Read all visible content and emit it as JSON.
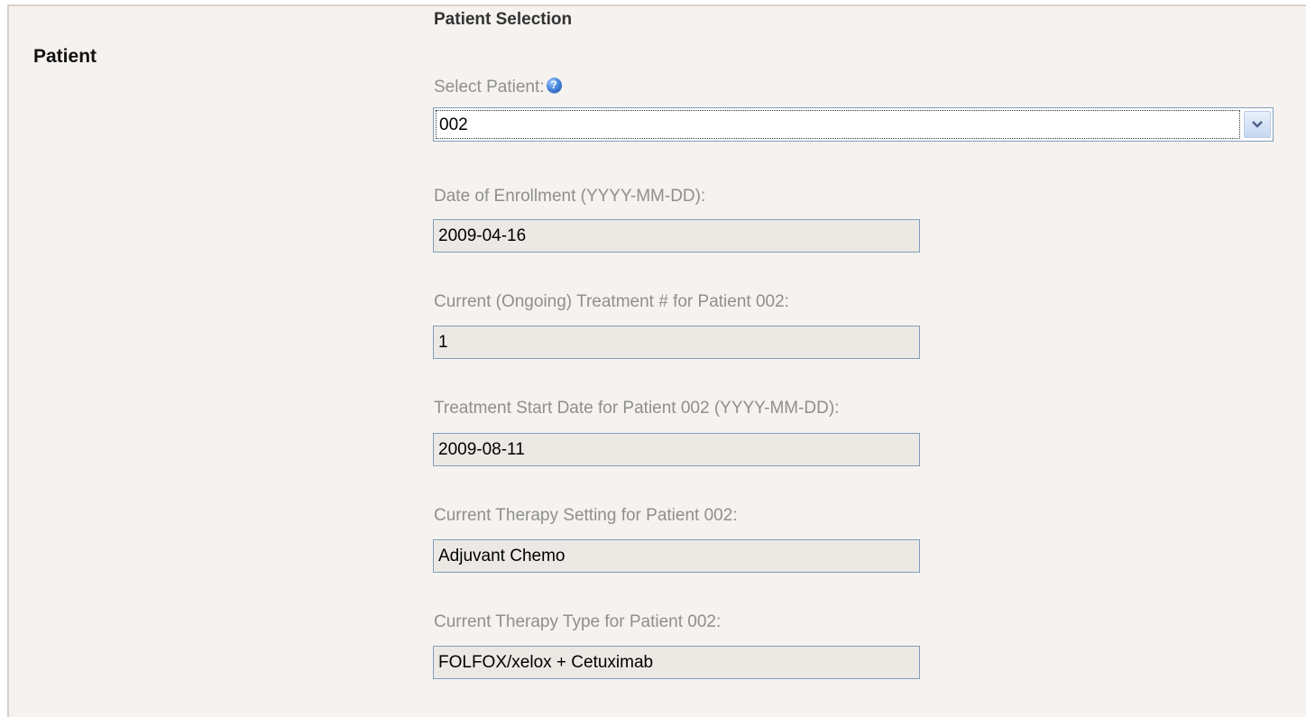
{
  "section": {
    "label": "Patient",
    "heading": "Patient Selection"
  },
  "select_patient": {
    "label": "Select Patient:",
    "help_icon": "help-icon",
    "value": "002"
  },
  "fields": [
    {
      "label": "Date of Enrollment (YYYY-MM-DD):",
      "value": "2009-04-16"
    },
    {
      "label": "Current (Ongoing) Treatment # for Patient 002:",
      "value": "1"
    },
    {
      "label": "Treatment Start Date for Patient 002 (YYYY-MM-DD):",
      "value": "2009-08-11"
    },
    {
      "label": "Current Therapy Setting for Patient 002:",
      "value": "Adjuvant Chemo"
    },
    {
      "label": "Current Therapy Type for Patient 002:",
      "value": "FOLFOX/xelox + Cetuximab"
    }
  ],
  "colors": {
    "panel_background": "#f5f2ef",
    "field_background": "#ece9e4",
    "field_border": "#7f9db9",
    "label_text": "#8f8f8f"
  }
}
